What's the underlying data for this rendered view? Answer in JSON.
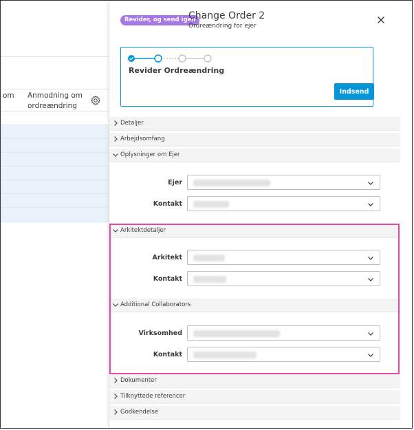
{
  "background": {
    "col1_header": "om",
    "col2_header_line1": "Anmodning om",
    "col2_header_line2": "ordreændring",
    "gear_icon": "gear-icon"
  },
  "panel": {
    "status_badge": "Revider, og send igen",
    "title": "Change Order 2",
    "subtitle": "Ordreændring for ejer",
    "close_icon": "close-icon"
  },
  "workflow": {
    "step_title": "Revider Ordreændring",
    "submit_label": "Indsend",
    "steps": [
      "completed",
      "current",
      "pending",
      "pending"
    ],
    "accent_color": "#0696d7"
  },
  "sections": {
    "details": "Detaljer",
    "scope": "Arbejdsomfang",
    "owner_info": "Oplysninger om Ejer",
    "architect": "Arkitektdetaljer",
    "collaborators": "Additional Collaborators",
    "documents": "Dokumenter",
    "references": "Tilknyttede referencer",
    "approval": "Godkendelse"
  },
  "owner_fields": {
    "owner_label": "Ejer",
    "contact_label": "Kontakt"
  },
  "architect_fields": {
    "architect_label": "Arkitekt",
    "contact_label": "Kontakt"
  },
  "collaborator_fields": {
    "company_label": "Virksomhed",
    "contact_label": "Kontakt"
  },
  "highlight_color": "#e34ca6"
}
